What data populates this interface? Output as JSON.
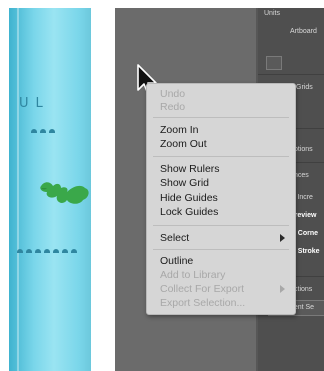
{
  "artboard": {
    "text": "UL"
  },
  "panel": {
    "items": [
      "Units",
      "Artboard",
      "Grids",
      "ptions",
      "nces",
      "nl Incre",
      "Preview",
      "le Corne",
      "le Stroke",
      "ctions",
      "ment Se"
    ]
  },
  "menu": {
    "undo": "Undo",
    "redo": "Redo",
    "zoom_in": "Zoom In",
    "zoom_out": "Zoom Out",
    "show_rulers": "Show Rulers",
    "show_grid": "Show Grid",
    "hide_guides": "Hide Guides",
    "lock_guides": "Lock Guides",
    "select": "Select",
    "outline": "Outline",
    "add_to_library": "Add to Library",
    "collect_for_export": "Collect For Export",
    "export_selection": "Export Selection..."
  },
  "colors": {
    "artboard": "#7ad6ea",
    "canvas": "#6b6b6b",
    "panel": "#4f4f4f",
    "menu": "#d6d6d6"
  }
}
